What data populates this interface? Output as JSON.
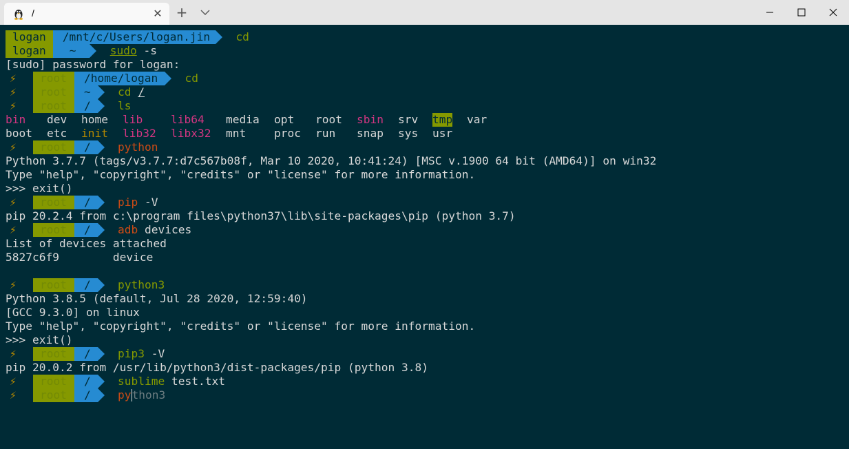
{
  "tab": {
    "title": "/",
    "icon": "linux-penguin-icon"
  },
  "window": {
    "minimize": "minimize-icon",
    "maximize": "maximize-icon",
    "close": "close-icon"
  },
  "colors": {
    "terminal_bg": "#002b36",
    "user_seg": "#859900",
    "path_seg": "#268bd2",
    "cmd_green": "#859900",
    "cmd_orange": "#cb4b16",
    "dir_pink": "#d33682"
  },
  "term": {
    "l1": {
      "user": "logan",
      "path": "/mnt/c/Users/logan.jin",
      "cmd": "cd"
    },
    "l2": {
      "user": "logan",
      "path": "~",
      "cmd": "sudo",
      "args": " -s"
    },
    "l3": {
      "text": "[sudo] password for logan:"
    },
    "l4": {
      "bolt": "⚡",
      "user": "root",
      "path": "/home/logan",
      "cmd": "cd"
    },
    "l5": {
      "bolt": "⚡",
      "user": "root",
      "path": "~",
      "cmd": "cd",
      "args": "/"
    },
    "l6": {
      "bolt": "⚡",
      "user": "root",
      "path": "/",
      "cmd": "ls"
    },
    "ls1": [
      "bin",
      "dev",
      "home",
      "lib",
      "lib64",
      "media",
      "opt",
      "root",
      "sbin",
      "srv",
      "tmp",
      "var"
    ],
    "ls2": [
      "boot",
      "etc",
      "init",
      "lib32",
      "libx32",
      "mnt",
      "proc",
      "run",
      "snap",
      "sys",
      "usr"
    ],
    "l9": {
      "bolt": "⚡",
      "user": "root",
      "path": "/",
      "cmd": "python"
    },
    "l10": {
      "text": "Python 3.7.7 (tags/v3.7.7:d7c567b08f, Mar 10 2020, 10:41:24) [MSC v.1900 64 bit (AMD64)] on win32"
    },
    "l11": {
      "text": "Type \"help\", \"copyright\", \"credits\" or \"license\" for more information."
    },
    "l12": {
      "text": ">>> exit()"
    },
    "l13": {
      "bolt": "⚡",
      "user": "root",
      "path": "/",
      "cmd": "pip",
      "args": " -V"
    },
    "l14": {
      "text": "pip 20.2.4 from c:\\program files\\python37\\lib\\site-packages\\pip (python 3.7)"
    },
    "l15": {
      "bolt": "⚡",
      "user": "root",
      "path": "/",
      "cmd": "adb",
      "args": " devices"
    },
    "l16": {
      "text": "List of devices attached"
    },
    "l17": {
      "text": "5827c6f9        device"
    },
    "l19": {
      "bolt": "⚡",
      "user": "root",
      "path": "/",
      "cmd": "python3"
    },
    "l20": {
      "text": "Python 3.8.5 (default, Jul 28 2020, 12:59:40)"
    },
    "l21": {
      "text": "[GCC 9.3.0] on linux"
    },
    "l22": {
      "text": "Type \"help\", \"copyright\", \"credits\" or \"license\" for more information."
    },
    "l23": {
      "text": ">>> exit()"
    },
    "l24": {
      "bolt": "⚡",
      "user": "root",
      "path": "/",
      "cmd": "pip3",
      "args": " -V"
    },
    "l25": {
      "text": "pip 20.0.2 from /usr/lib/python3/dist-packages/pip (python 3.8)"
    },
    "l26": {
      "bolt": "⚡",
      "user": "root",
      "path": "/",
      "cmd": "sublime",
      "args": " test.txt"
    },
    "l27": {
      "bolt": "⚡",
      "user": "root",
      "path": "/",
      "typed": "py",
      "suggestion": "thon3"
    }
  }
}
